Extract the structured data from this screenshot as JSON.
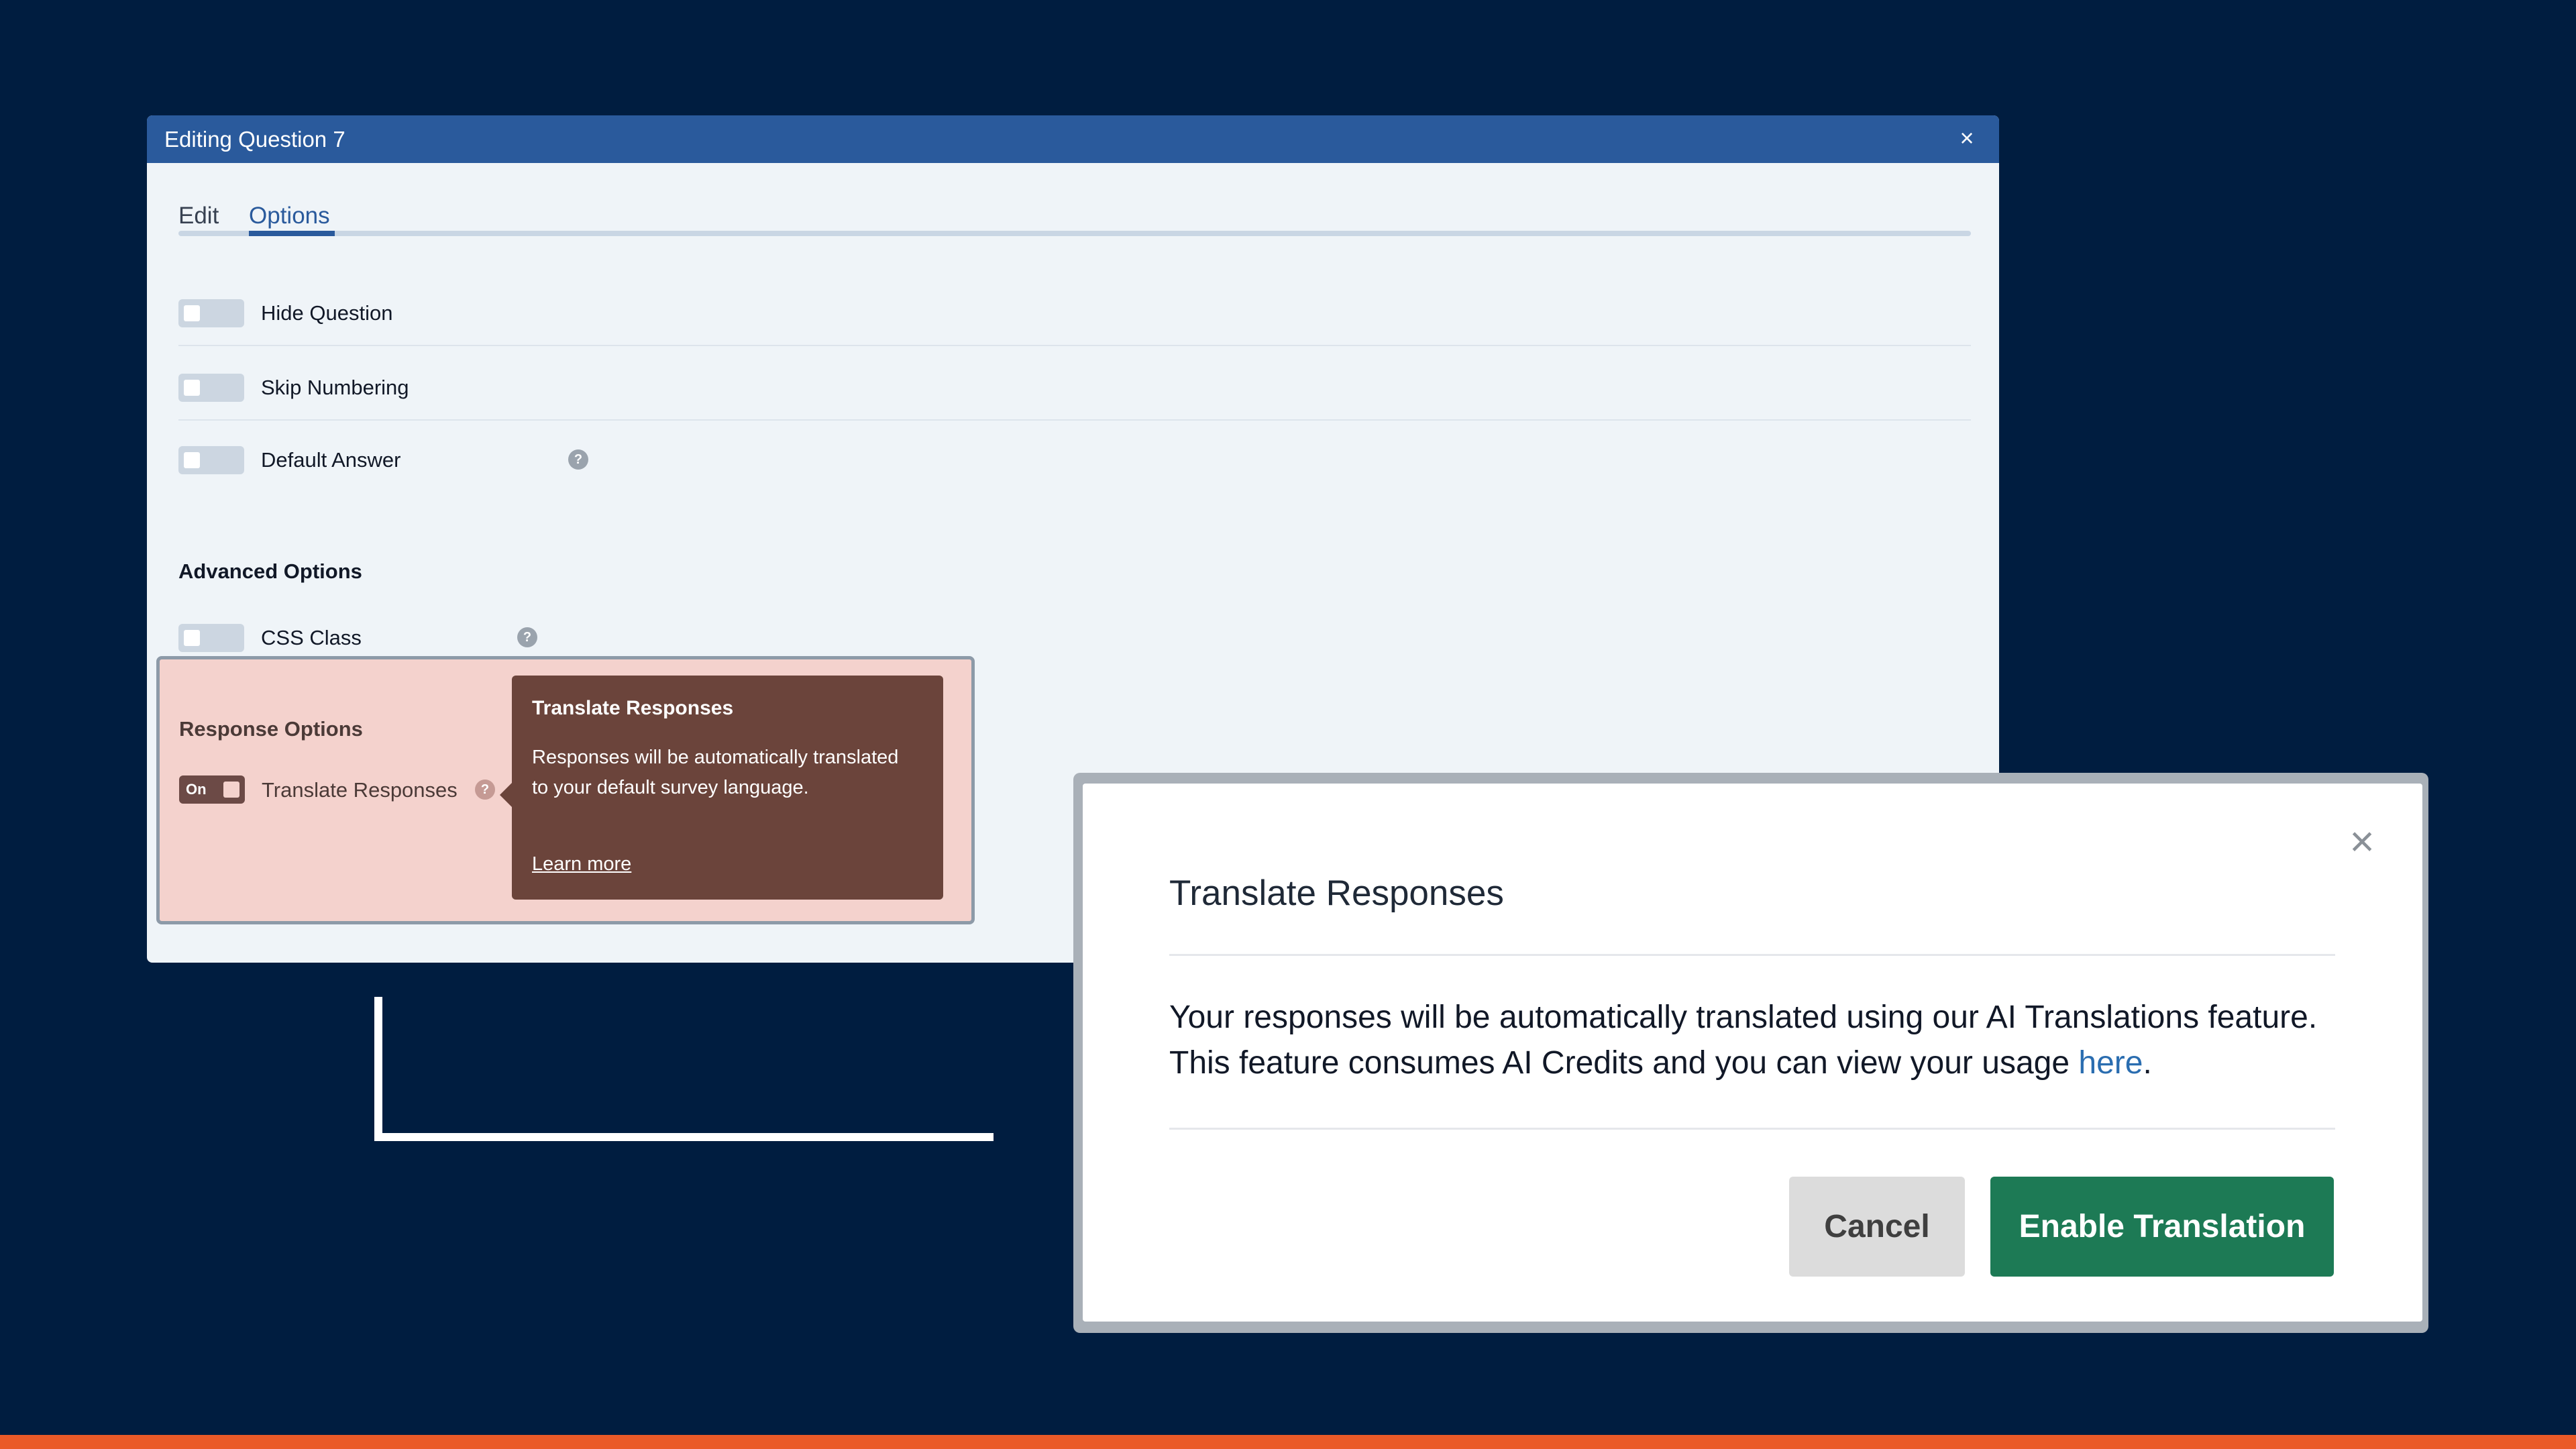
{
  "editor": {
    "title": "Editing Question 7",
    "close_glyph": "×",
    "tabs": [
      {
        "label": "Edit",
        "active": false
      },
      {
        "label": "Options",
        "active": true
      }
    ],
    "options": [
      {
        "label": "Hide Question",
        "enabled": false,
        "has_help": false
      },
      {
        "label": "Skip Numbering",
        "enabled": false,
        "has_help": false
      },
      {
        "label": "Default Answer",
        "enabled": false,
        "has_help": true
      }
    ],
    "advanced_heading": "Advanced Options",
    "advanced_options": [
      {
        "label": "CSS Class",
        "enabled": false,
        "has_help": true
      }
    ],
    "help_glyph": "?"
  },
  "response_options": {
    "heading": "Response Options",
    "toggle_state_text": "On",
    "label": "Translate Responses",
    "tooltip": {
      "title": "Translate Responses",
      "body": "Responses will be automatically translated to your default survey language.",
      "link": "Learn more"
    }
  },
  "modal": {
    "title": "Translate Responses",
    "body_line1": "Your responses will be automatically translated using our AI Translations feature.",
    "body_line2_prefix": "This feature consumes AI Credits and you can view your usage ",
    "body_link": "here",
    "body_line2_suffix": ".",
    "close_glyph": "×",
    "cancel_label": "Cancel",
    "confirm_label": "Enable Translation"
  },
  "colors": {
    "background": "#001d40",
    "titlebar": "#2a5a9c",
    "accent_bar": "#ea5a28",
    "highlight": "#f4d2cd",
    "tooltip": "#6b443b",
    "confirm_button": "#1d7a55"
  }
}
